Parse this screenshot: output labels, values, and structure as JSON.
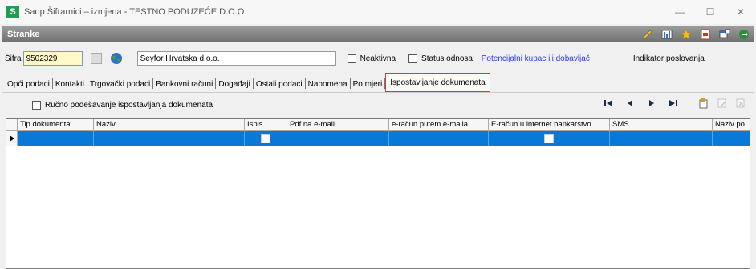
{
  "window": {
    "title": "Saop Šifrarnici – izmjena  - TESTNO PODUZEĆE D.O.O.",
    "logo_letter": "S",
    "minimize": "—",
    "maximize": "☐",
    "close": "✕"
  },
  "panel": {
    "title": "Stranke"
  },
  "form": {
    "sifra_label": "Šifra",
    "sifra_value": "9502329",
    "naziv_value": "Seyfor Hrvatska d.o.o.",
    "neaktivna_label": "Neaktivna",
    "status_label": "Status odnosa:",
    "status_value": "Potencijalni kupac ili dobavljač",
    "indikator_label": "Indikator poslovanja"
  },
  "tabs": [
    "Opći podaci",
    "Kontakti",
    "Trgovački podaci",
    "Bankovni računi",
    "Događaji",
    "Ostali podaci",
    "Napomena",
    "Po mjeri",
    "Ispostavljanje dokumenata"
  ],
  "toolbar": {
    "manual_label": "Ručno podešavanje ispostavljanja dokumenata",
    "nav_first": "⏮",
    "nav_prev": "◀",
    "nav_next": "▶",
    "nav_last": "⏭"
  },
  "grid": {
    "columns": [
      "Tip dokumenta",
      "Naziv",
      "Ispis",
      "Pdf na e-mail",
      "e-račun putem e-maila",
      "E-račun u internet bankarstvo",
      "SMS",
      "Naziv po"
    ]
  },
  "colors": {
    "accent": "#0a78d7",
    "link": "#2a37ff",
    "active_tab_border": "#d03b3b"
  }
}
